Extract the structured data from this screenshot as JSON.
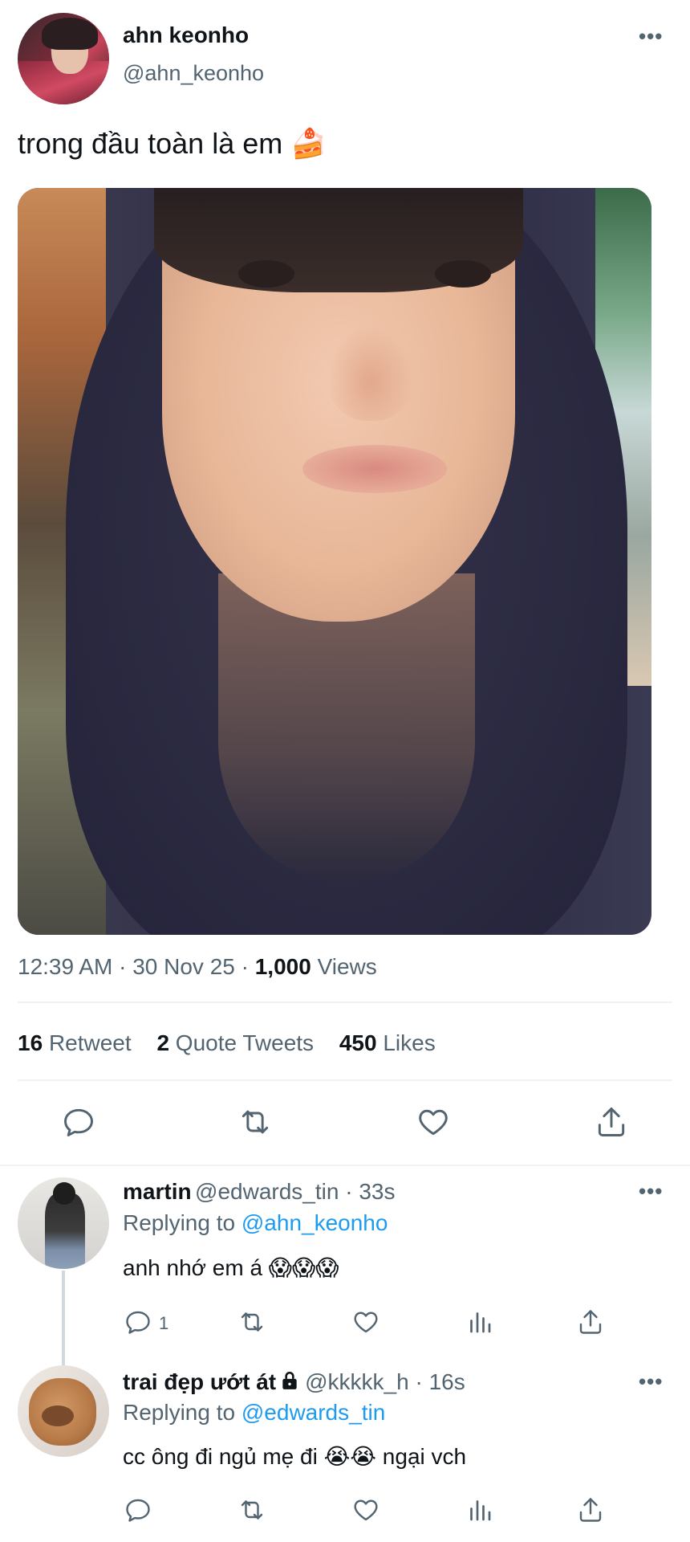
{
  "tweet": {
    "author_name": "ahn keonho",
    "author_handle": "@ahn_keonho",
    "text": "trong đầu toàn là em 🍰",
    "time": "12:39 AM",
    "date": "30 Nov 25",
    "views_count": "1,000",
    "views_label": "Views",
    "retweets_count": "16",
    "retweets_label": "Retweet",
    "quotes_count": "2",
    "quotes_label": "Quote Tweets",
    "likes_count": "450",
    "likes_label": "Likes",
    "more": "•••"
  },
  "replies": [
    {
      "name": "martin",
      "handle": "@edwards_tin",
      "time": "33s",
      "replying_prefix": "Replying to",
      "replying_to": "@ahn_keonho",
      "text": "anh nhớ em á 😱😱😱",
      "reply_count": "1",
      "more": "•••"
    },
    {
      "name": "trai đẹp ướt át",
      "handle": "@kkkkk_h",
      "time": "16s",
      "replying_prefix": "Replying to",
      "replying_to": "@edwards_tin",
      "text": "cc ông đi ngủ mẹ đi 😭😭 ngại vch",
      "more": "•••"
    }
  ],
  "separator": " · ",
  "colors": {
    "accent": "#1d9bf0",
    "muted": "#536471",
    "text": "#0f1419",
    "divider": "#eff3f4"
  },
  "icons": [
    "reply-icon",
    "retweet-icon",
    "like-icon",
    "share-icon",
    "stats-icon",
    "lock-icon",
    "more-icon"
  ]
}
